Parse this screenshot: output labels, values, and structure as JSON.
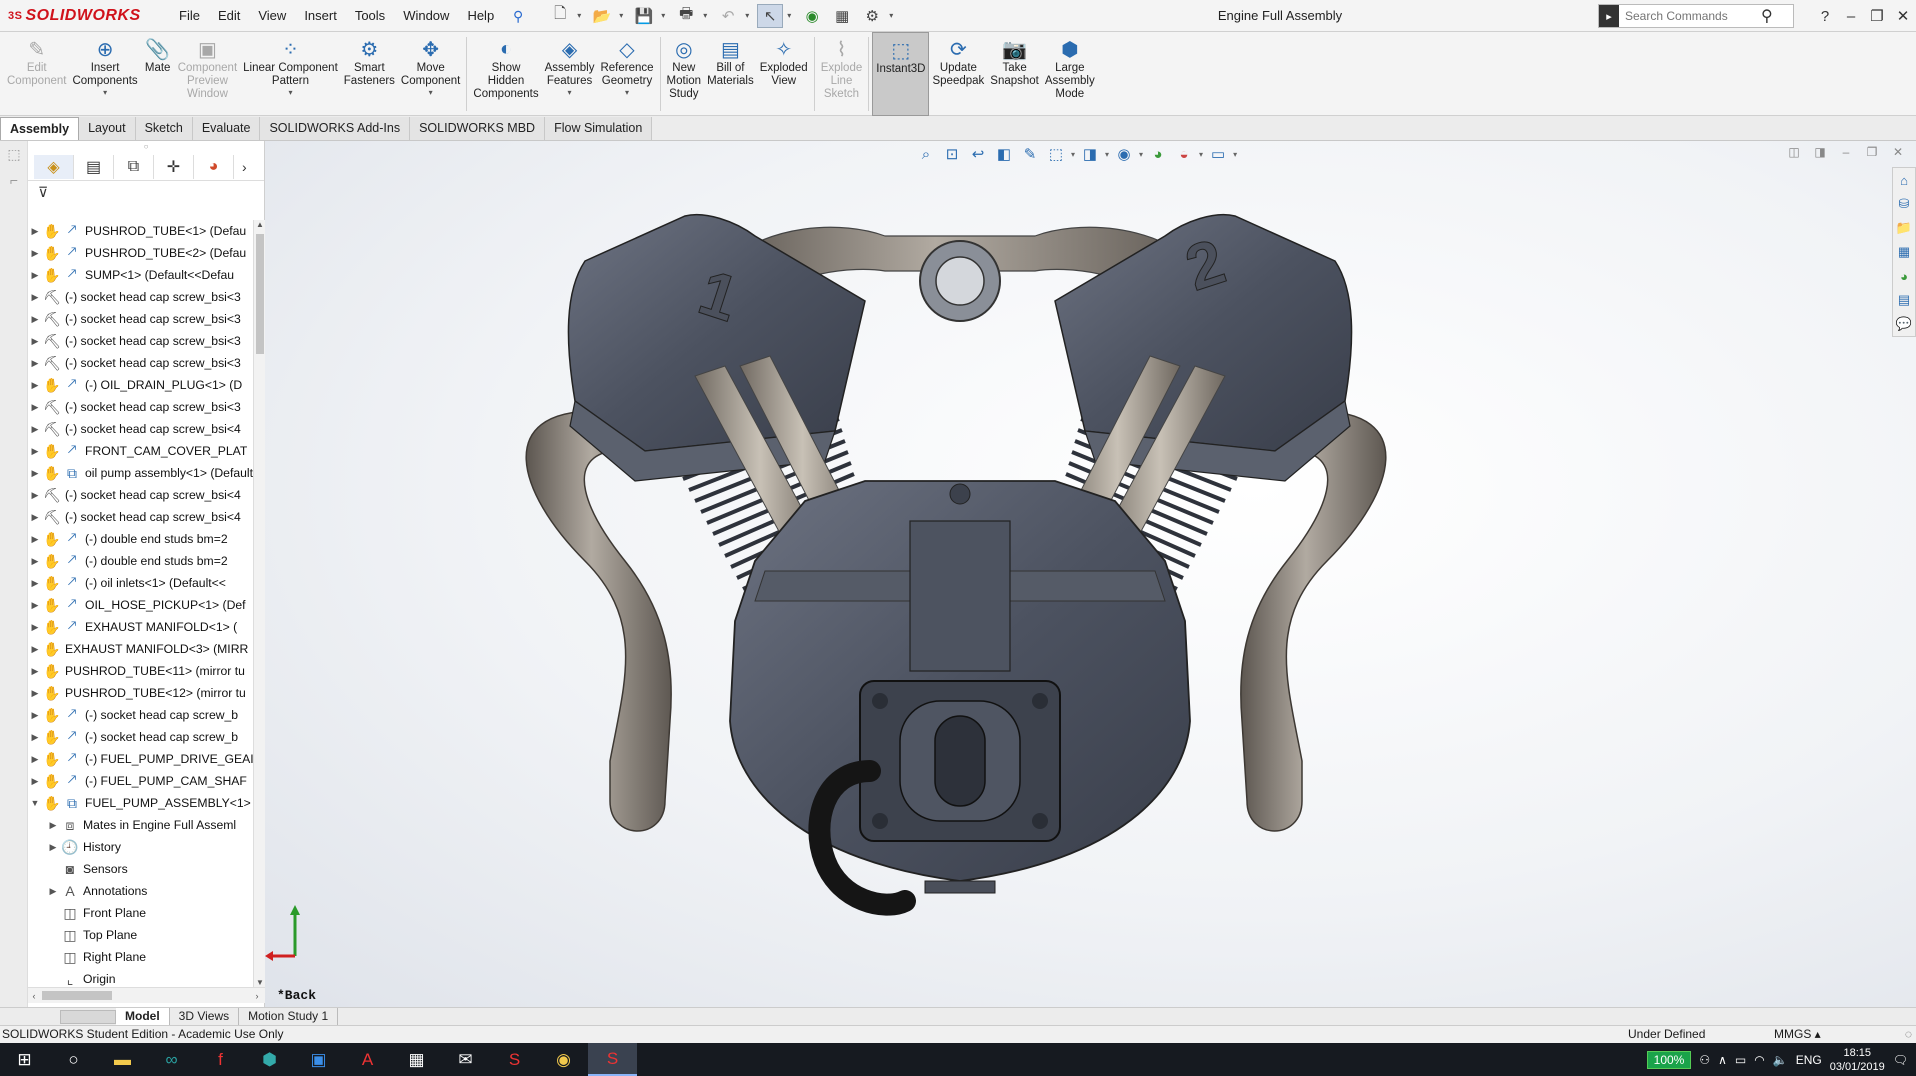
{
  "app": {
    "logo": "SOLIDWORKS",
    "logo_prefix": "3S",
    "doc_title": "Engine Full Assembly",
    "colors": {
      "brand": "#d0121b",
      "accent": "#2b6cb0",
      "selected": "#c9c9c9"
    }
  },
  "menu": [
    "File",
    "Edit",
    "View",
    "Insert",
    "Tools",
    "Window",
    "Help"
  ],
  "search": {
    "placeholder": "Search Commands"
  },
  "commands": [
    {
      "label": "Edit\nComponent",
      "icon": "edit-component-icon",
      "glyph": "✎",
      "disabled": true
    },
    {
      "label": "Insert\nComponents",
      "icon": "insert-components-icon",
      "glyph": "⊕",
      "disabled": false,
      "dropdown": true
    },
    {
      "label": "Mate",
      "icon": "mate-icon",
      "glyph": "📎",
      "disabled": false
    },
    {
      "label": "Component\nPreview\nWindow",
      "icon": "preview-window-icon",
      "glyph": "▣",
      "disabled": true
    },
    {
      "label": "Linear Component\nPattern",
      "icon": "pattern-icon",
      "glyph": "⁘",
      "disabled": false,
      "dropdown": true
    },
    {
      "label": "Smart\nFasteners",
      "icon": "fastener-icon",
      "glyph": "⚙",
      "disabled": false
    },
    {
      "label": "Move\nComponent",
      "icon": "move-icon",
      "glyph": "✥",
      "disabled": false,
      "dropdown": true
    },
    {
      "label": "Show\nHidden\nComponents",
      "icon": "show-hidden-icon",
      "glyph": "◐",
      "disabled": false
    },
    {
      "label": "Assembly\nFeatures",
      "icon": "assembly-features-icon",
      "glyph": "◈",
      "disabled": false,
      "dropdown": true
    },
    {
      "label": "Reference\nGeometry",
      "icon": "reference-geometry-icon",
      "glyph": "◇",
      "disabled": false,
      "dropdown": true
    },
    {
      "label": "New\nMotion\nStudy",
      "icon": "motion-study-icon",
      "glyph": "◎",
      "disabled": false
    },
    {
      "label": "Bill of\nMaterials",
      "icon": "bom-icon",
      "glyph": "▤",
      "disabled": false
    },
    {
      "label": "Exploded\nView",
      "icon": "exploded-view-icon",
      "glyph": "✧",
      "disabled": false
    },
    {
      "label": "Explode\nLine\nSketch",
      "icon": "explode-line-icon",
      "glyph": "⌇",
      "disabled": true
    },
    {
      "label": "Instant3D",
      "icon": "instant3d-icon",
      "glyph": "⬚",
      "disabled": false,
      "active": true
    },
    {
      "label": "Update\nSpeedpak",
      "icon": "speedpak-icon",
      "glyph": "⟳",
      "disabled": false
    },
    {
      "label": "Take\nSnapshot",
      "icon": "snapshot-icon",
      "glyph": "📷",
      "disabled": false
    },
    {
      "label": "Large\nAssembly\nMode",
      "icon": "large-assembly-icon",
      "glyph": "⬢",
      "disabled": false
    }
  ],
  "tabs": [
    "Assembly",
    "Layout",
    "Sketch",
    "Evaluate",
    "SOLIDWORKS Add-Ins",
    "SOLIDWORKS MBD",
    "Flow Simulation"
  ],
  "active_tab": "Assembly",
  "tree": [
    {
      "label": "PUSHROD_TUBE<1> (Defau",
      "type": "part",
      "expand": "collapsed"
    },
    {
      "label": "PUSHROD_TUBE<2> (Defau",
      "type": "part",
      "expand": "collapsed"
    },
    {
      "label": "SUMP<1> (Default<<Defau",
      "type": "part",
      "expand": "collapsed"
    },
    {
      "label": "(-) socket head cap screw_bsi<3",
      "type": "screw",
      "expand": "collapsed"
    },
    {
      "label": "(-) socket head cap screw_bsi<3",
      "type": "screw",
      "expand": "collapsed"
    },
    {
      "label": "(-) socket head cap screw_bsi<3",
      "type": "screw",
      "expand": "collapsed"
    },
    {
      "label": "(-) socket head cap screw_bsi<3",
      "type": "screw",
      "expand": "collapsed"
    },
    {
      "label": "(-) OIL_DRAIN_PLUG<1> (D",
      "type": "part",
      "expand": "collapsed"
    },
    {
      "label": "(-) socket head cap screw_bsi<3",
      "type": "screw",
      "expand": "collapsed"
    },
    {
      "label": "(-) socket head cap screw_bsi<4",
      "type": "screw",
      "expand": "collapsed"
    },
    {
      "label": "FRONT_CAM_COVER_PLAT",
      "type": "part",
      "expand": "collapsed"
    },
    {
      "label": "oil pump assembly<1> (Default",
      "type": "assembly",
      "expand": "collapsed"
    },
    {
      "label": "(-) socket head cap screw_bsi<4",
      "type": "screw",
      "expand": "collapsed"
    },
    {
      "label": "(-) socket head cap screw_bsi<4",
      "type": "screw",
      "expand": "collapsed"
    },
    {
      "label": "(-) double end studs bm=2",
      "type": "part",
      "expand": "collapsed"
    },
    {
      "label": "(-) double end studs bm=2",
      "type": "part",
      "expand": "collapsed"
    },
    {
      "label": "(-) oil inlets<1> (Default<<",
      "type": "part",
      "expand": "collapsed"
    },
    {
      "label": "OIL_HOSE_PICKUP<1> (Def",
      "type": "part",
      "expand": "collapsed"
    },
    {
      "label": "EXHAUST MANIFOLD<1> (",
      "type": "part",
      "expand": "collapsed"
    },
    {
      "label": "EXHAUST MANIFOLD<3> (MIRR",
      "type": "mirror",
      "expand": "collapsed"
    },
    {
      "label": "PUSHROD_TUBE<11> (mirror tu",
      "type": "mirror",
      "expand": "collapsed"
    },
    {
      "label": "PUSHROD_TUBE<12> (mirror tu",
      "type": "mirror",
      "expand": "collapsed"
    },
    {
      "label": "(-) socket head cap screw_b",
      "type": "part",
      "expand": "collapsed"
    },
    {
      "label": "(-) socket head cap screw_b",
      "type": "part",
      "expand": "collapsed"
    },
    {
      "label": "(-) FUEL_PUMP_DRIVE_GEAI",
      "type": "part",
      "expand": "collapsed"
    },
    {
      "label": "(-) FUEL_PUMP_CAM_SHAF",
      "type": "part",
      "expand": "collapsed"
    },
    {
      "label": "FUEL_PUMP_ASSEMBLY<1>",
      "type": "assembly",
      "expand": "expanded"
    },
    {
      "label": "Mates in Engine Full Asseml",
      "type": "mates",
      "expand": "collapsed",
      "indent": 1
    },
    {
      "label": "History",
      "type": "history",
      "expand": "collapsed",
      "indent": 1
    },
    {
      "label": "Sensors",
      "type": "sensors",
      "expand": "none",
      "indent": 1
    },
    {
      "label": "Annotations",
      "type": "annotations",
      "expand": "collapsed",
      "indent": 1
    },
    {
      "label": "Front Plane",
      "type": "plane",
      "expand": "none",
      "indent": 1
    },
    {
      "label": "Top Plane",
      "type": "plane",
      "expand": "none",
      "indent": 1
    },
    {
      "label": "Right Plane",
      "type": "plane",
      "expand": "none",
      "indent": 1
    },
    {
      "label": "Origin",
      "type": "origin",
      "expand": "none",
      "indent": 1
    }
  ],
  "viewport": {
    "view_label": "*Back"
  },
  "model_tabs": [
    "Model",
    "3D Views",
    "Motion Study 1"
  ],
  "status": {
    "edition": "SOLIDWORKS Student Edition - Academic Use Only",
    "state": "Under Defined",
    "units": "MMGS"
  },
  "taskbar": {
    "zoom": "100%",
    "lang": "ENG",
    "time": "18:15",
    "date": "03/01/2019"
  }
}
